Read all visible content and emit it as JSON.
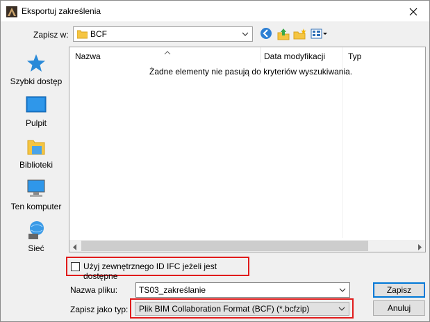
{
  "window": {
    "title": "Eksportuj zakreślenia"
  },
  "toolbar": {
    "save_in_label": "Zapisz w:",
    "location": "BCF",
    "icons": [
      "back-icon",
      "up-folder-icon",
      "new-folder-icon",
      "view-menu-icon"
    ]
  },
  "places": [
    {
      "label": "Szybki dostęp",
      "icon": "quick-access-icon"
    },
    {
      "label": "Pulpit",
      "icon": "desktop-icon"
    },
    {
      "label": "Biblioteki",
      "icon": "libraries-icon"
    },
    {
      "label": "Ten komputer",
      "icon": "this-pc-icon"
    },
    {
      "label": "Sieć",
      "icon": "network-icon"
    }
  ],
  "file_list": {
    "columns": [
      "Nazwa",
      "Data modyfikacji",
      "Typ"
    ],
    "empty_message": "Żadne elementy nie pasują do kryteriów wyszukiwania."
  },
  "options": {
    "ifc_checkbox_label": "Użyj zewnętrznego ID IFC jeżeli jest dostępne",
    "ifc_checked": false
  },
  "form": {
    "file_name_label": "Nazwa pliku:",
    "file_name_value": "TS03_zakreślanie",
    "file_type_label": "Zapisz jako typ:",
    "file_type_value": "Plik BIM Collaboration Format (BCF) (*.bcfzip)"
  },
  "buttons": {
    "save": "Zapisz",
    "cancel": "Anuluj"
  },
  "colors": {
    "highlight": "#e01b1b",
    "accent": "#0078d7"
  }
}
